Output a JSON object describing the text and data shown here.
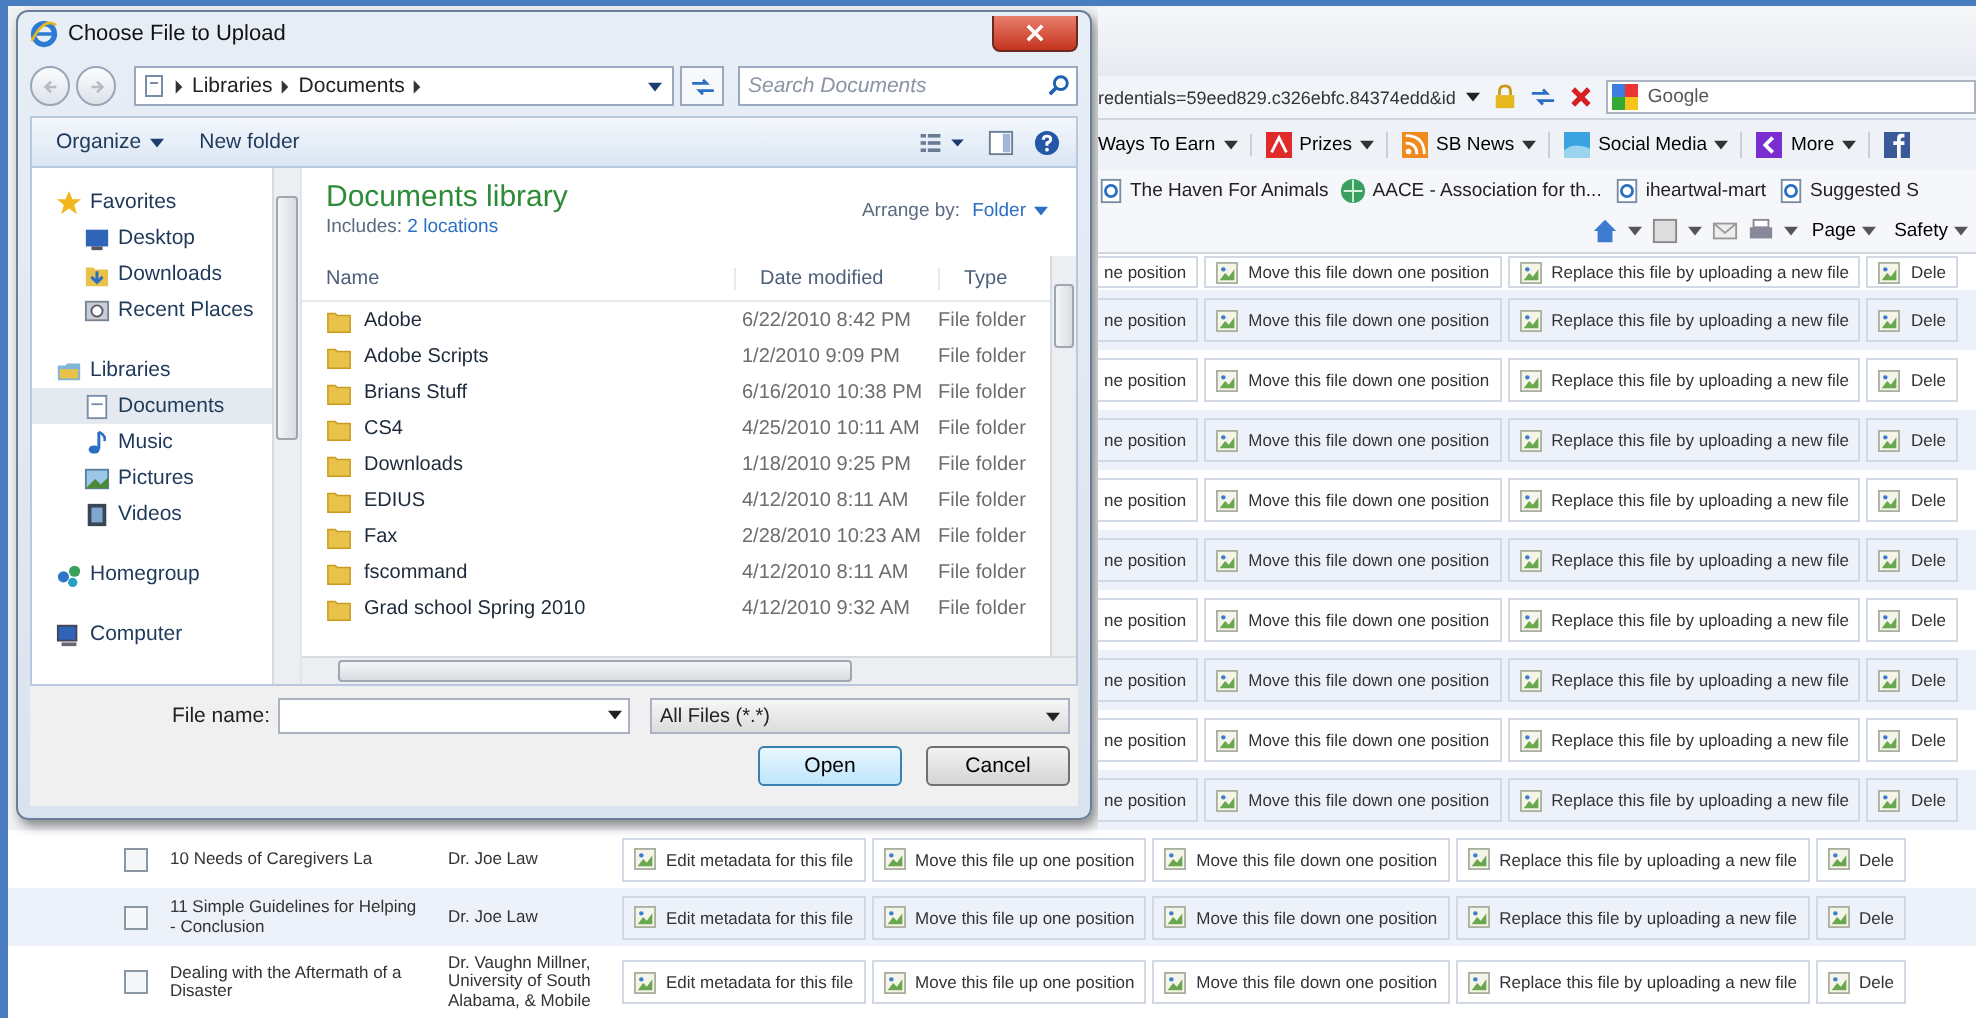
{
  "dialog": {
    "title": "Choose File to Upload",
    "breadcrumb": [
      "Libraries",
      "Documents"
    ],
    "search": {
      "placeholder": "Search Documents"
    },
    "toolbar": {
      "organize": "Organize",
      "new_folder": "New folder"
    },
    "nav": [
      {
        "label": "Favorites",
        "kind": "star",
        "selected": false,
        "children": [
          {
            "label": "Desktop",
            "kind": "desktop",
            "selected": false
          },
          {
            "label": "Downloads",
            "kind": "download",
            "selected": false
          },
          {
            "label": "Recent Places",
            "kind": "recent",
            "selected": false
          }
        ]
      },
      {
        "label": "Libraries",
        "kind": "library",
        "selected": false,
        "children": [
          {
            "label": "Documents",
            "kind": "document",
            "selected": true
          },
          {
            "label": "Music",
            "kind": "music",
            "selected": false
          },
          {
            "label": "Pictures",
            "kind": "pictures",
            "selected": false
          },
          {
            "label": "Videos",
            "kind": "videos",
            "selected": false
          }
        ]
      },
      {
        "label": "Homegroup",
        "kind": "homegroup",
        "selected": false
      },
      {
        "label": "Computer",
        "kind": "computer",
        "selected": false
      }
    ],
    "library": {
      "title": "Documents library",
      "includes_label": "Includes:",
      "includes_link": "2 locations",
      "arrange_label": "Arrange by:",
      "arrange_value": "Folder"
    },
    "columns": [
      "Name",
      "Date modified",
      "Type"
    ],
    "files": [
      {
        "name": "Adobe",
        "date": "6/22/2010 8:42 PM",
        "type": "File folder",
        "selected": false
      },
      {
        "name": "Adobe Scripts",
        "date": "1/2/2010 9:09 PM",
        "type": "File folder",
        "selected": false
      },
      {
        "name": "Brians Stuff",
        "date": "6/16/2010 10:38 PM",
        "type": "File folder",
        "selected": false
      },
      {
        "name": "CS4",
        "date": "4/25/2010 10:11 AM",
        "type": "File folder",
        "selected": false
      },
      {
        "name": "Downloads",
        "date": "1/18/2010 9:25 PM",
        "type": "File folder",
        "selected": false
      },
      {
        "name": "EDIUS",
        "date": "4/12/2010 8:11 AM",
        "type": "File folder",
        "selected": false
      },
      {
        "name": "Fax",
        "date": "2/28/2010 10:23 AM",
        "type": "File folder",
        "selected": false
      },
      {
        "name": "fscommand",
        "date": "4/12/2010 8:11 AM",
        "type": "File folder",
        "selected": false
      },
      {
        "name": "Grad school Spring 2010",
        "date": "4/12/2010 9:32 AM",
        "type": "File folder",
        "selected": false
      }
    ],
    "file_name": {
      "label": "File name:"
    },
    "filter": "All Files (*.*)",
    "buttons": [
      {
        "label": "Open",
        "default": true
      },
      {
        "label": "Cancel",
        "default": false
      }
    ]
  },
  "browser": {
    "address": {
      "url": "redentials=59eed829.c326ebfc.84374edd&id"
    },
    "search": {
      "placeholder": "Google"
    },
    "toolbar": [
      {
        "label": "Ways To Earn",
        "kind": "text"
      },
      {
        "label": "Prizes",
        "kind": "prize"
      },
      {
        "label": "SB News",
        "kind": "feed"
      },
      {
        "label": "Social Media",
        "kind": "media"
      },
      {
        "label": "More",
        "kind": "more"
      }
    ],
    "favorites": [
      {
        "label": "The Haven For Animals",
        "kind": "page"
      },
      {
        "label": "AACE - Association for th...",
        "kind": "globe"
      },
      {
        "label": "iheartwal-mart",
        "kind": "page"
      },
      {
        "label": "Suggested S",
        "kind": "page"
      }
    ],
    "commands": [
      "Page",
      "Safety"
    ]
  },
  "table": {
    "covered_rows": [
      {
        "cells": [
          "ne position",
          "Move this file down one position",
          "Replace this file by uploading a new file",
          "Dele"
        ]
      },
      {
        "cells": [
          "ne position",
          "Move this file down one position",
          "Replace this file by uploading a new file",
          "Dele"
        ]
      },
      {
        "cells": [
          "ne position",
          "Move this file down one position",
          "Replace this file by uploading a new file",
          "Dele"
        ]
      },
      {
        "cells": [
          "ne position",
          "Move this file down one position",
          "Replace this file by uploading a new file",
          "Dele"
        ]
      },
      {
        "cells": [
          "ne position",
          "Move this file down one position",
          "Replace this file by uploading a new file",
          "Dele"
        ]
      },
      {
        "cells": [
          "ne position",
          "Move this file down one position",
          "Replace this file by uploading a new file",
          "Dele"
        ]
      },
      {
        "cells": [
          "ne position",
          "Move this file down one position",
          "Replace this file by uploading a new file",
          "Dele"
        ]
      },
      {
        "cells": [
          "ne position",
          "Move this file down one position",
          "Replace this file by uploading a new file",
          "Dele"
        ]
      },
      {
        "cells": [
          "ne position",
          "Move this file down one position",
          "Replace this file by uploading a new file",
          "Dele"
        ]
      },
      {
        "cells": [
          "ne position",
          "Move this file down one position",
          "Replace this file by uploading a new file",
          "Dele"
        ]
      }
    ],
    "rows": [
      {
        "checked": false,
        "title": "10 Needs of Caregivers La",
        "author": "Dr. Joe Law",
        "actions": [
          "Edit metadata for this file",
          "Move this file up one position",
          "Move this file down one position",
          "Replace this file by uploading a new file",
          "Dele"
        ]
      },
      {
        "checked": false,
        "title": "11 Simple Guidelines for Helping - Conclusion",
        "author": "Dr. Joe Law",
        "actions": [
          "Edit metadata for this file",
          "Move this file up one position",
          "Move this file down one position",
          "Replace this file by uploading a new file",
          "Dele"
        ]
      },
      {
        "checked": false,
        "title": "Dealing with the Aftermath of a Disaster",
        "author": "Dr. Vaughn Millner, University of South Alabama, & Mobile",
        "actions": [
          "Edit metadata for this file",
          "Move this file up one position",
          "Move this file down one position",
          "Replace this file by uploading a new file",
          "Dele"
        ]
      }
    ]
  }
}
